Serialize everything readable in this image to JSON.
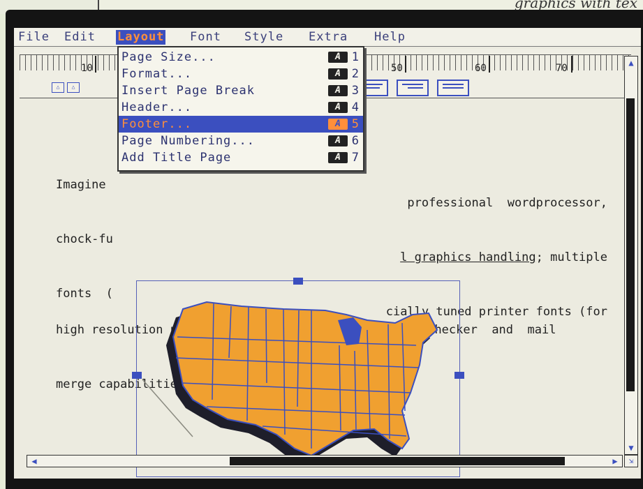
{
  "magazine": {
    "caption": "graphics with tex"
  },
  "menubar": {
    "items": [
      "File",
      "Edit",
      "Layout",
      "Font",
      "Style",
      "Extra",
      "Help"
    ],
    "active": "Layout"
  },
  "ruler": {
    "numbers": [
      "10",
      "50",
      "60",
      "70"
    ]
  },
  "layout_menu": {
    "items": [
      {
        "label": "Page Size...",
        "key": "1"
      },
      {
        "label": "Format...",
        "key": "2"
      },
      {
        "label": "Insert Page Break",
        "key": "3"
      },
      {
        "label": "Header...",
        "key": "4"
      },
      {
        "label": "Footer...",
        "key": "5"
      },
      {
        "label": "Page Numbering...",
        "key": "6"
      },
      {
        "label": "Add Title Page",
        "key": "7"
      }
    ],
    "selected": "Footer...",
    "shortcut_glyph": "A"
  },
  "document": {
    "line1_a": "Imagine",
    "line1_b": "professional  wordprocessor,",
    "line2_a": "chock-fu",
    "line2_link": "l graphics handling",
    "line2_b": "; multiple",
    "line3_a": "fonts  (",
    "line3_b": "cially tuned printer fonts (for",
    "line4": "high resolution printing; a 90,000  word  spelling  checker  and  mail",
    "line5": "merge capabilities."
  },
  "colors": {
    "accent": "#3b4fbf",
    "highlight": "#ff8f3a",
    "map_fill": "#f0a030"
  },
  "graphic": {
    "subject": "map of the contiguous United States"
  }
}
